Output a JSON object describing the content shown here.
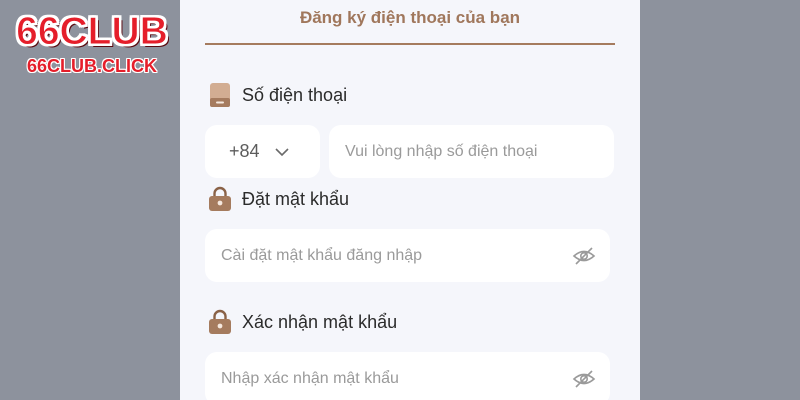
{
  "logo": {
    "main": "66CLUB",
    "sub": "66CLUB.CLICK"
  },
  "form": {
    "title": "Đăng ký điện thoại của bạn",
    "phone": {
      "label": "Số điện thoại",
      "country_code": "+84",
      "placeholder": "Vui lòng nhập số điện thoại"
    },
    "password": {
      "label": "Đặt mật khẩu",
      "placeholder": "Cài đặt mật khẩu đăng nhập"
    },
    "confirm": {
      "label": "Xác nhận mật khẩu",
      "placeholder": "Nhập xác nhận mật khẩu"
    }
  },
  "icons": {
    "phone": "phone-icon",
    "lock": "lock-icon",
    "eye_hidden": "eye-off-icon",
    "chevron": "chevron-down-icon"
  },
  "colors": {
    "accent": "#a57b5e",
    "panel_bg": "#f5f6fb",
    "page_bg": "#8d929d",
    "logo_red": "#e51e2a"
  }
}
